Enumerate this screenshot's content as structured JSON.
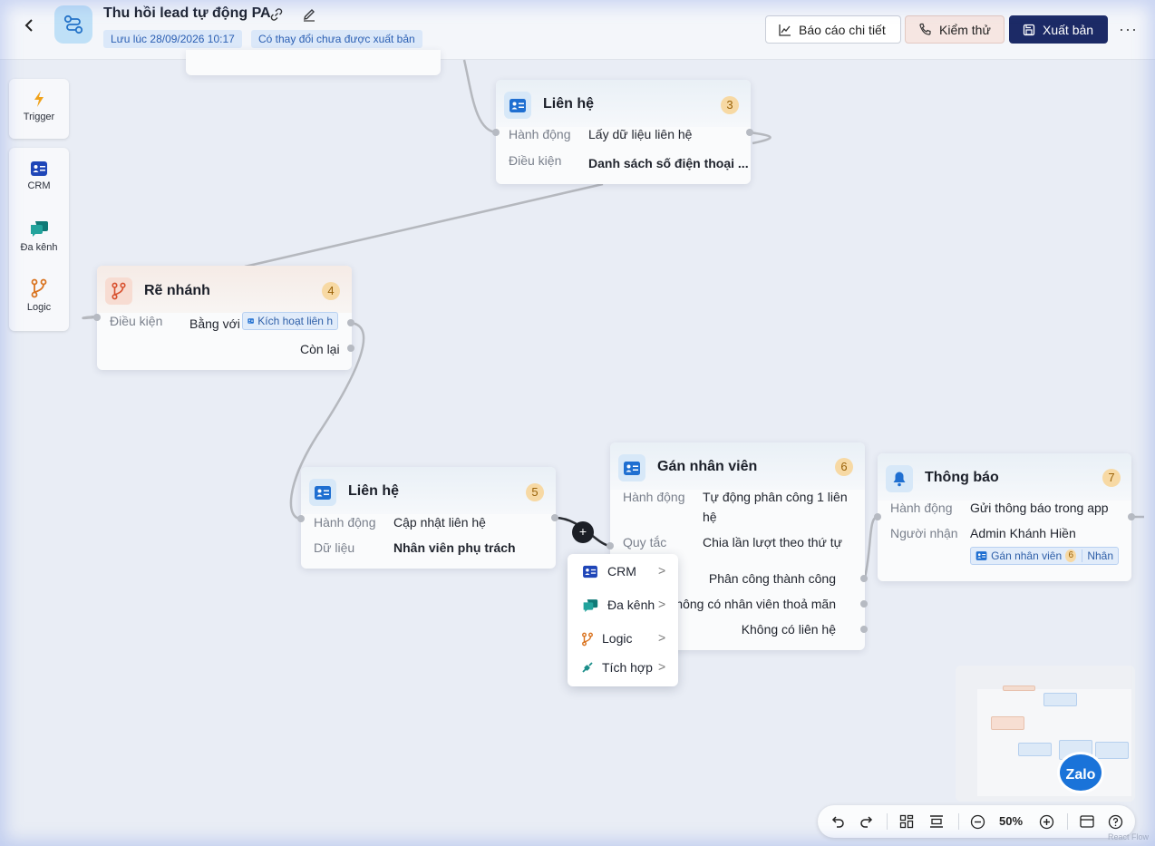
{
  "header": {
    "title": "Thu hồi lead tự động PA",
    "saved_chip": "Lưu lúc 28/09/2026 10:17",
    "unpublished_chip": "Có thay đổi chưa được xuất bản",
    "report_label": "Báo cáo chi tiết",
    "test_label": "Kiểm thử",
    "publish_label": "Xuất bản",
    "more_label": "···"
  },
  "palette": {
    "trigger": "Trigger",
    "crm": "CRM",
    "omni": "Đa kênh",
    "logic": "Logic"
  },
  "nodes": {
    "contact3": {
      "title": "Liên hệ",
      "badge": "3",
      "action_label": "Hành động",
      "action_value": "Lấy dữ liệu liên hệ",
      "cond_label": "Điều kiện",
      "cond_value": "Danh sách số điện thoại ..."
    },
    "branch4": {
      "title": "Rẽ nhánh",
      "badge": "4",
      "cond_label": "Điều kiện",
      "equals_label": "Bằng với",
      "tag_label": "Kích hoạt liên h",
      "else_label": "Còn lại"
    },
    "contact5": {
      "title": "Liên hệ",
      "badge": "5",
      "action_label": "Hành động",
      "action_value": "Cập nhật liên hệ",
      "data_label": "Dữ liệu",
      "data_value": "Nhân viên phụ trách"
    },
    "assign6": {
      "title": "Gán nhân viên",
      "badge": "6",
      "action_label": "Hành động",
      "action_value_1": "Tự động phân công 1 liên",
      "action_value_2": "hệ",
      "rule_label": "Quy tắc",
      "rule_value": "Chia lần lượt theo thứ tự",
      "out_success": "Phân công thành công",
      "out_nostaff": "hông có nhân viên thoả mãn",
      "out_nocontact": "Không có liên hệ"
    },
    "notify7": {
      "title": "Thông báo",
      "badge": "7",
      "action_label": "Hành động",
      "action_value": "Gửi thông báo trong app",
      "recipient_label": "Người nhận",
      "recipient_value": "Admin Khánh Hiền",
      "tag_label": "Gán nhân viên",
      "tag_badge": "6",
      "tag_extra": "Nhân"
    }
  },
  "context_menu": {
    "plus": "+",
    "items": [
      {
        "label": "CRM",
        "chevron": ">"
      },
      {
        "label": "Đa kênh",
        "chevron": ">"
      },
      {
        "label": "Logic",
        "chevron": ">"
      },
      {
        "label": "Tích hợp",
        "chevron": ">"
      }
    ]
  },
  "zalo_label": "Zalo",
  "toolbar": {
    "zoom": "50%"
  },
  "watermark": "React Flow",
  "colors": {
    "accent_navy": "#1c2a66",
    "crm_blue": "#1f56c9",
    "omni_teal": "#1b8e8a",
    "logic_orange": "#d9731f",
    "branch_red": "#d8502e",
    "badge_orange": "#f7d9a4"
  }
}
